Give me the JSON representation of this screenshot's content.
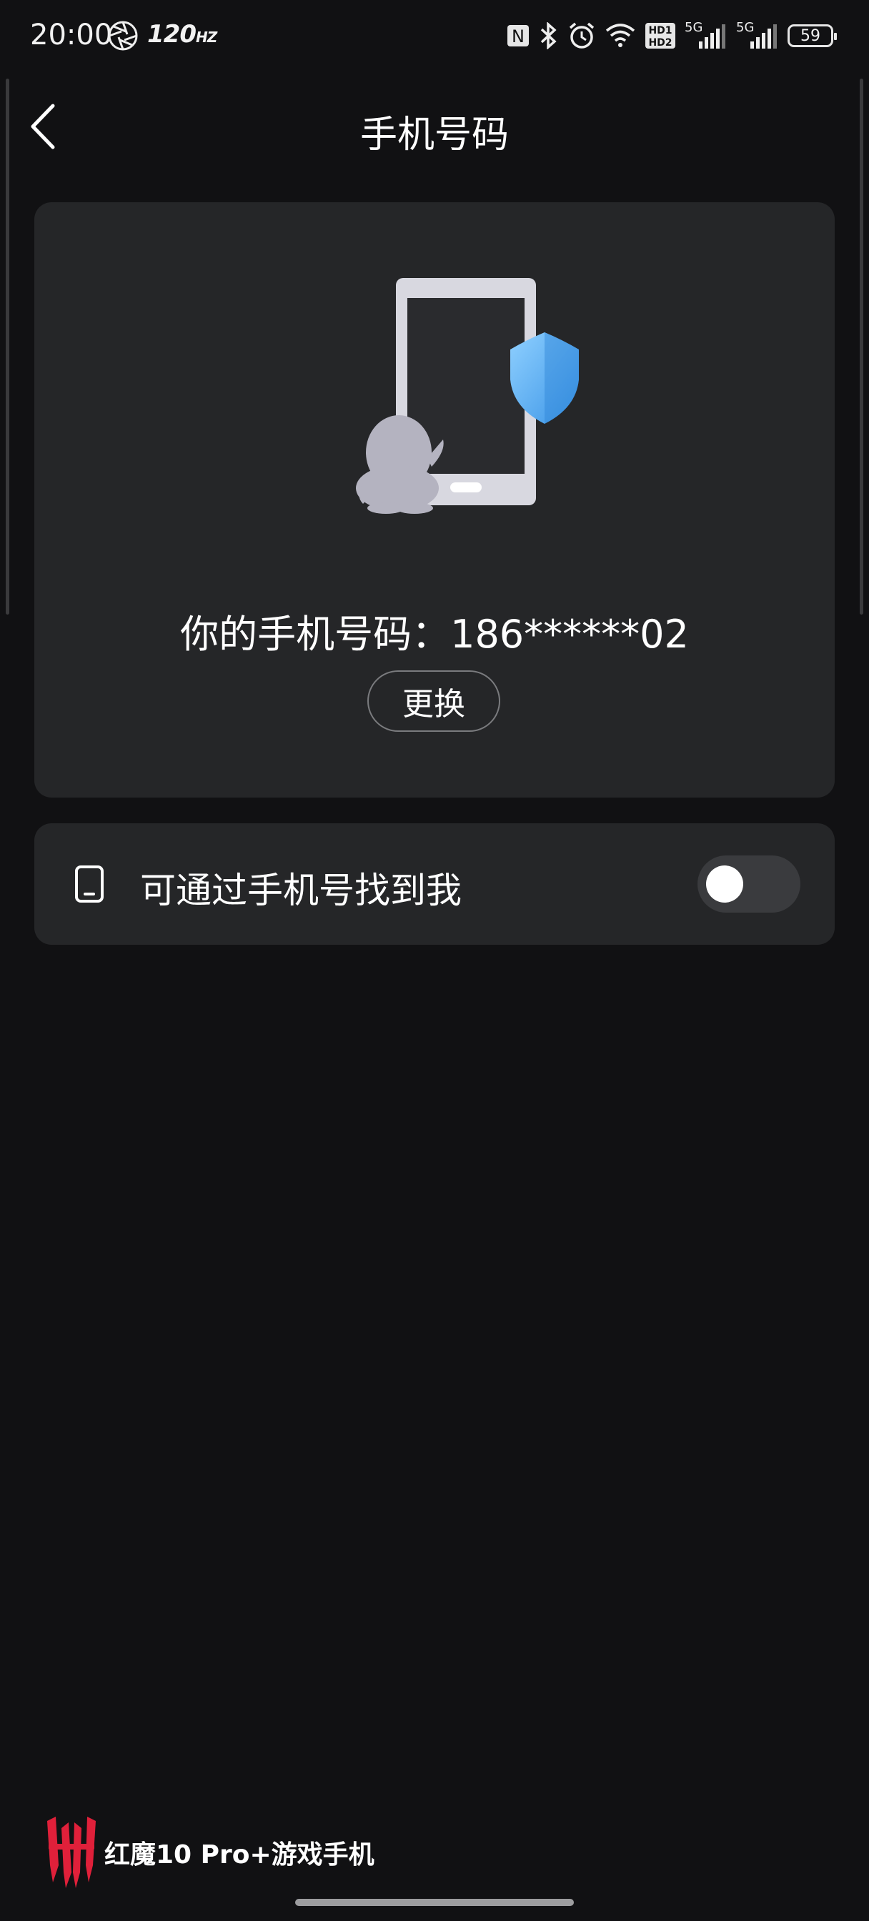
{
  "status_bar": {
    "time": "20:00",
    "refresh_rate": "120",
    "refresh_unit": "HZ",
    "icons": [
      "nfc-icon",
      "bluetooth-icon",
      "alarm-icon",
      "wifi-icon",
      "hd-icon",
      "signal-icon",
      "signal-icon"
    ],
    "signal_1_tag": "5G",
    "signal_2_tag": "5G",
    "battery": "59"
  },
  "header": {
    "title": "手机号码",
    "back_icon": "chevron-left-icon"
  },
  "phone_card": {
    "phone_line": "你的手机号码：186******02",
    "change_label": "更换",
    "illustration": "phone-shield-penguin-illustration"
  },
  "toggle_row": {
    "icon": "phone-icon",
    "label": "可通过手机号找到我",
    "enabled": false
  },
  "footer": {
    "brand_text": "红魔10 Pro+游戏手机",
    "brand_logo": "red-magic-logo"
  },
  "colors": {
    "background": "#111113",
    "card": "#252628",
    "shield_accent": "#4aa8f0",
    "brand_red": "#e0203a"
  }
}
